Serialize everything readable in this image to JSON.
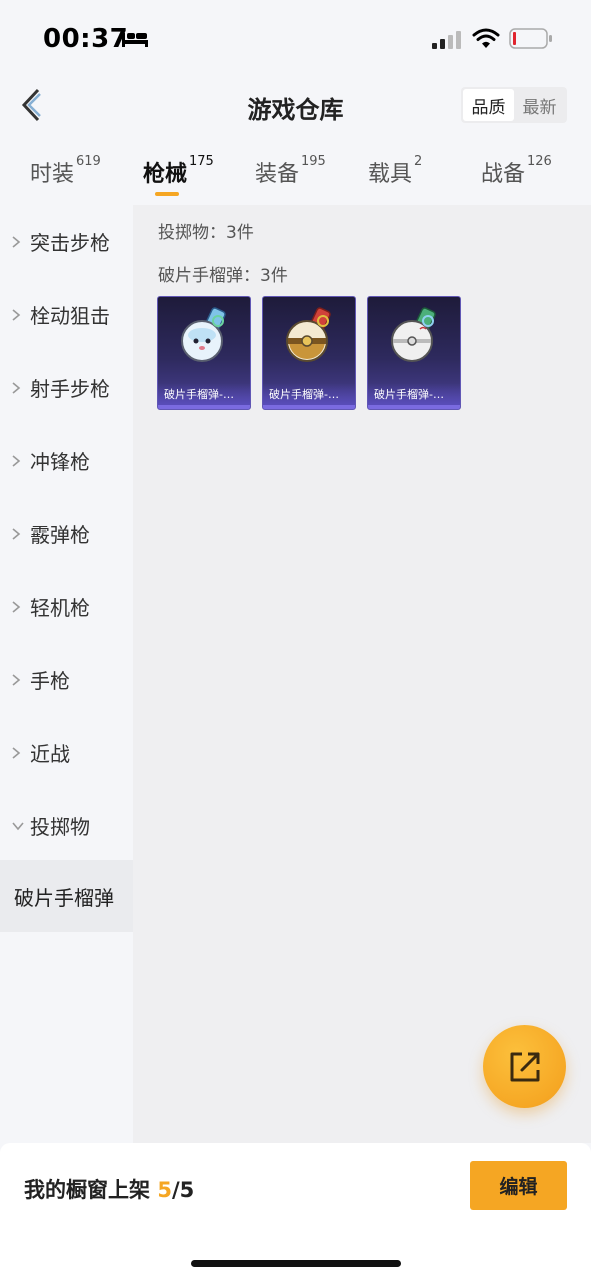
{
  "status_bar": {
    "time": "00:37"
  },
  "header": {
    "title": "游戏仓库",
    "sort": [
      "品质",
      "最新"
    ]
  },
  "tabs": [
    {
      "label": "时装",
      "count": "619"
    },
    {
      "label": "枪械",
      "count": "175"
    },
    {
      "label": "装备",
      "count": "195"
    },
    {
      "label": "载具",
      "count": "2"
    },
    {
      "label": "战备",
      "count": "126"
    }
  ],
  "sidebar": {
    "items": [
      {
        "label": "突击步枪"
      },
      {
        "label": "栓动狙击"
      },
      {
        "label": "射手步枪"
      },
      {
        "label": "冲锋枪"
      },
      {
        "label": "霰弹枪"
      },
      {
        "label": "轻机枪"
      },
      {
        "label": "手枪"
      },
      {
        "label": "近战"
      },
      {
        "label": "投掷物"
      }
    ],
    "sub_item": "破片手榴弹"
  },
  "content": {
    "category_summary": "投掷物：3件",
    "subcategory_summary": "破片手榴弹：3件",
    "items": [
      {
        "name": "破片手榴弹-…"
      },
      {
        "name": "破片手榴弹-…"
      },
      {
        "name": "破片手榴弹-…"
      }
    ]
  },
  "bottom_bar": {
    "showcase_label": "我的橱窗上架",
    "showcase_current": "5",
    "showcase_total": "/5",
    "edit_label": "编辑"
  },
  "colors": {
    "accent": "#f5a623",
    "card_bg": "#2e2a5e"
  }
}
